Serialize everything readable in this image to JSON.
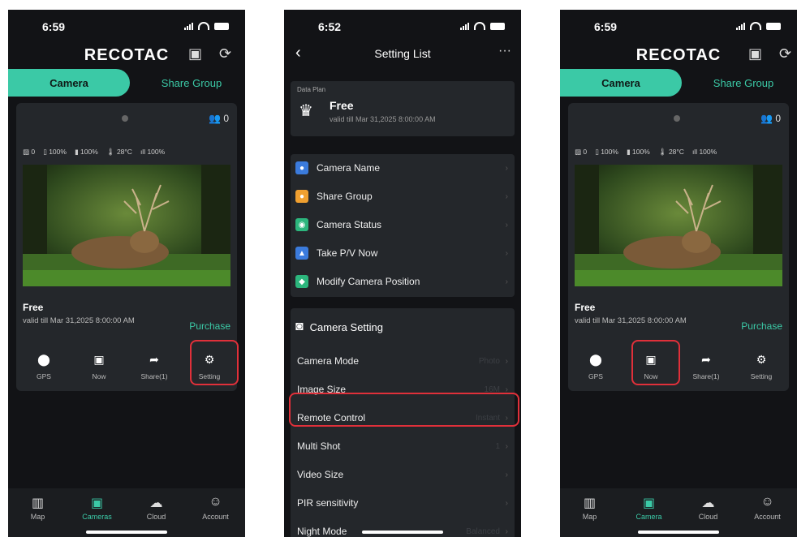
{
  "screen1": {
    "status_time": "6:59",
    "brand": "RECOTAC",
    "tabs": {
      "camera": "Camera",
      "share_group": "Share Group"
    },
    "people_count": "0",
    "info": {
      "photos": "0",
      "sd": "100%",
      "battery": "100%",
      "temp": "28°C",
      "signal": "100%"
    },
    "plan_name": "Free",
    "plan_valid": "valid till Mar 31,2025 8:00:00 AM",
    "purchase_label": "Purchase",
    "actions": [
      {
        "label": "GPS"
      },
      {
        "label": "Now"
      },
      {
        "label": "Share(1)"
      },
      {
        "label": "Setting"
      }
    ],
    "nav": [
      {
        "label": "Map"
      },
      {
        "label": "Cameras"
      },
      {
        "label": "Cloud"
      },
      {
        "label": "Account"
      }
    ]
  },
  "screen2": {
    "status_time": "6:52",
    "title": "Setting List",
    "data_plan_label": "Data Plan",
    "plan_name": "Free",
    "plan_valid": "valid till Mar 31,2025 8:00:00 AM",
    "group1": [
      {
        "label": "Camera Name",
        "color": "#3b7bdc"
      },
      {
        "label": "Share  Group",
        "color": "#f0a030"
      },
      {
        "label": "Camera Status",
        "color": "#2cb67d"
      },
      {
        "label": "Take P/V  Now",
        "color": "#3b7bdc"
      },
      {
        "label": "Modify Camera Position",
        "color": "#2cb67d"
      }
    ],
    "camera_setting_header": "Camera Setting",
    "group2": [
      {
        "label": "Camera Mode",
        "value": "Photo"
      },
      {
        "label": "Image Size",
        "value": "16M"
      },
      {
        "label": "Remote Control",
        "value": "Instant"
      },
      {
        "label": "Multi Shot",
        "value": "1"
      },
      {
        "label": "Video Size",
        "value": ""
      },
      {
        "label": "PIR sensitivity",
        "value": ""
      },
      {
        "label": "Night Mode",
        "value": "Balanced"
      }
    ]
  },
  "screen3": {
    "status_time": "6:59",
    "brand": "RECOTAC",
    "tabs": {
      "camera": "Camera",
      "share_group": "Share Group"
    },
    "people_count": "0",
    "info": {
      "photos": "0",
      "sd": "100%",
      "battery": "100%",
      "temp": "28°C",
      "signal": "100%"
    },
    "plan_name": "Free",
    "plan_valid": "valid till Mar 31,2025 8:00:00 AM",
    "purchase_label": "Purchase",
    "actions": [
      {
        "label": "GPS"
      },
      {
        "label": "Now"
      },
      {
        "label": "Share(1)"
      },
      {
        "label": "Setting"
      }
    ],
    "nav": [
      {
        "label": "Map"
      },
      {
        "label": "Camera"
      },
      {
        "label": "Cloud"
      },
      {
        "label": "Account"
      }
    ]
  },
  "colors": {
    "accent": "#3bc9a6",
    "highlight": "#e0303a",
    "background": "#121316",
    "card": "#24272b"
  }
}
